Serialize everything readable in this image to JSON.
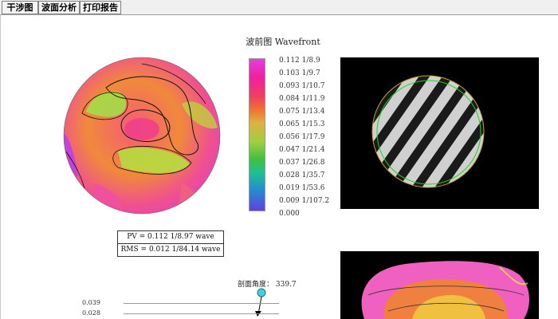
{
  "tabs": [
    {
      "label": "干涉图"
    },
    {
      "label": "波面分析"
    },
    {
      "label": "打印报告"
    }
  ],
  "wavefront": {
    "title": "波前图 Wavefront",
    "legend": [
      "0.112 1/8.9",
      "0.103 1/9.7",
      "0.093 1/10.7",
      "0.084 1/11.9",
      "0.075 1/13.4",
      "0.065 1/15.3",
      "0.056 1/17.9",
      "0.047 1/21.4",
      "0.037 1/26.8",
      "0.028 1/35.7",
      "0.019 1/53.6",
      "0.009 1/107.2",
      "0.000"
    ]
  },
  "stats": {
    "pv": "PV = 0.112  1/8.97  wave",
    "rms": "RMS = 0.012  1/84.14  wave"
  },
  "profile": {
    "angle_label": "剖面角度：  339.7",
    "ticks": [
      "0.039",
      "0.028"
    ]
  }
}
